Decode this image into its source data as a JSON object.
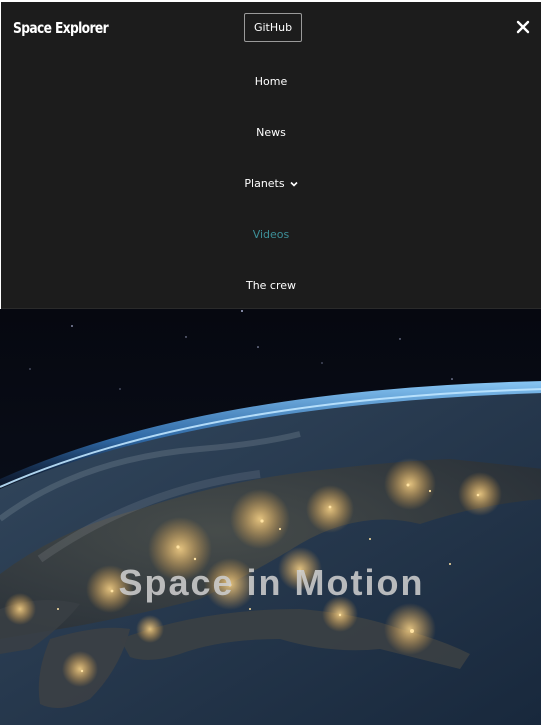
{
  "header": {
    "brand": "Space Explorer",
    "github_label": "GitHub"
  },
  "nav": {
    "items": [
      {
        "label": "Home"
      },
      {
        "label": "News"
      },
      {
        "label": "Planets"
      },
      {
        "label": "Videos"
      },
      {
        "label": "The crew"
      }
    ]
  },
  "hero": {
    "title": "Space in Motion"
  },
  "colors": {
    "nav_bg": "#1c1c1c",
    "active_link": "#3d8f98",
    "text": "#ffffff"
  },
  "icons": [
    "close-icon",
    "chevron-down-icon"
  ]
}
